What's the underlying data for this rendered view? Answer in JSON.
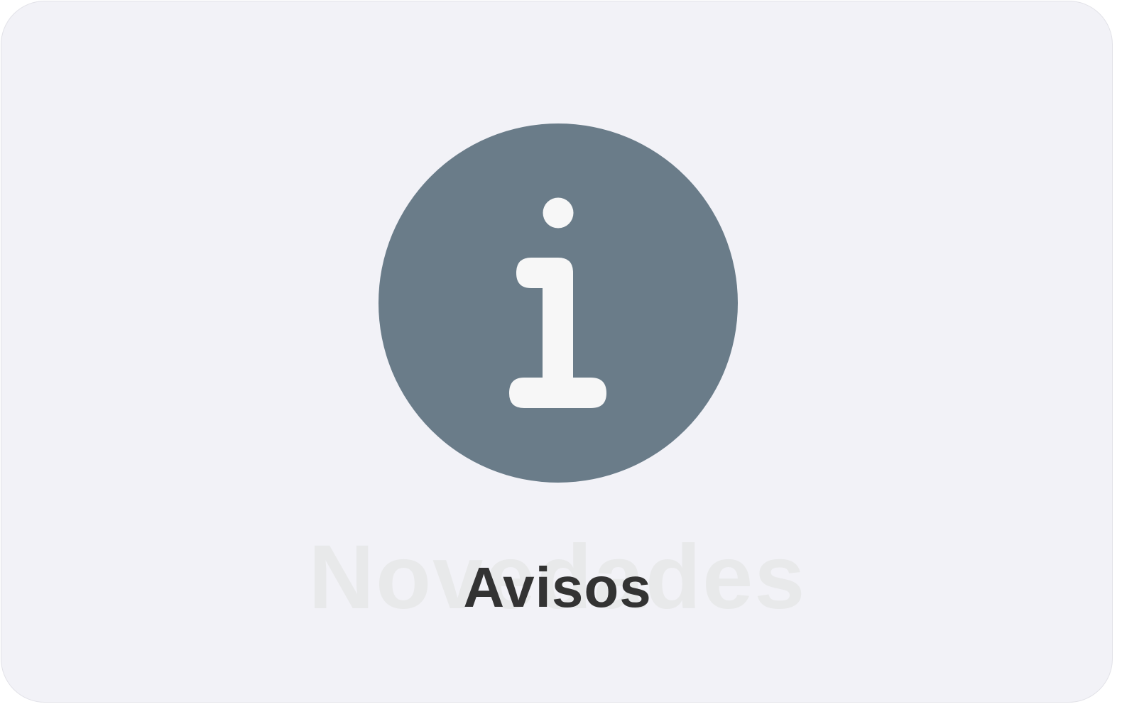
{
  "tile": {
    "label": "Avisos",
    "watermark": "Novedades",
    "icon": "info-icon"
  },
  "colors": {
    "background": "#f2f2f7",
    "icon_circle": "#6a7c89",
    "icon_glyph": "#f7f7f7",
    "label_text": "#333333",
    "watermark_text": "#e8e9ea"
  }
}
